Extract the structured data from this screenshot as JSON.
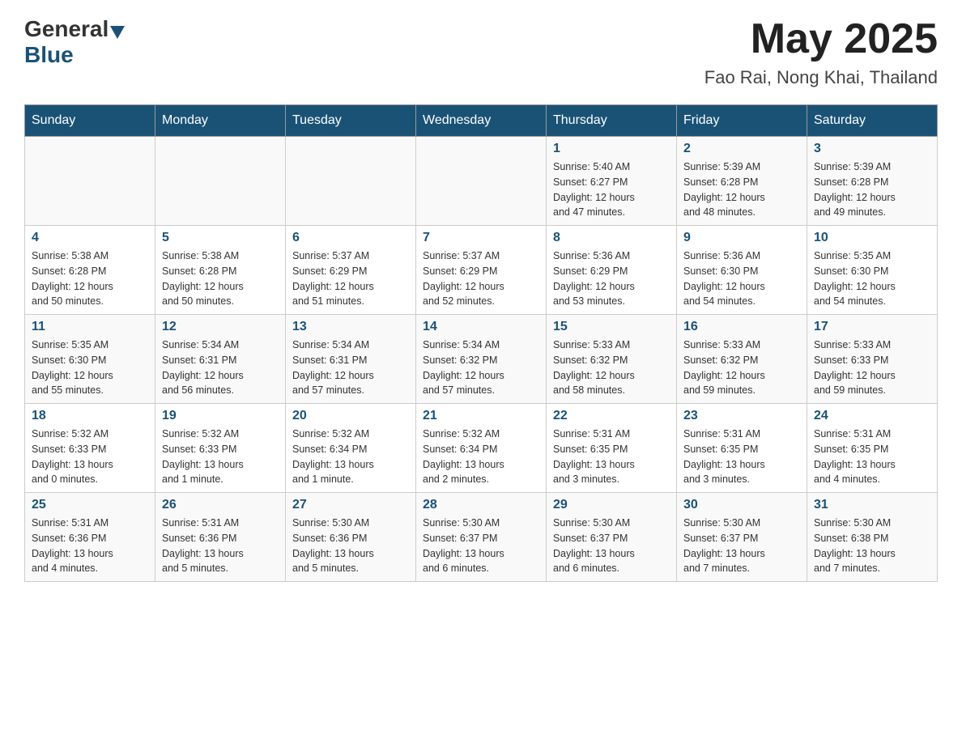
{
  "header": {
    "logo_general": "General",
    "logo_blue": "Blue",
    "title": "May 2025",
    "subtitle": "Fao Rai, Nong Khai, Thailand"
  },
  "calendar": {
    "days_of_week": [
      "Sunday",
      "Monday",
      "Tuesday",
      "Wednesday",
      "Thursday",
      "Friday",
      "Saturday"
    ],
    "weeks": [
      [
        {
          "day": "",
          "info": ""
        },
        {
          "day": "",
          "info": ""
        },
        {
          "day": "",
          "info": ""
        },
        {
          "day": "",
          "info": ""
        },
        {
          "day": "1",
          "info": "Sunrise: 5:40 AM\nSunset: 6:27 PM\nDaylight: 12 hours\nand 47 minutes."
        },
        {
          "day": "2",
          "info": "Sunrise: 5:39 AM\nSunset: 6:28 PM\nDaylight: 12 hours\nand 48 minutes."
        },
        {
          "day": "3",
          "info": "Sunrise: 5:39 AM\nSunset: 6:28 PM\nDaylight: 12 hours\nand 49 minutes."
        }
      ],
      [
        {
          "day": "4",
          "info": "Sunrise: 5:38 AM\nSunset: 6:28 PM\nDaylight: 12 hours\nand 50 minutes."
        },
        {
          "day": "5",
          "info": "Sunrise: 5:38 AM\nSunset: 6:28 PM\nDaylight: 12 hours\nand 50 minutes."
        },
        {
          "day": "6",
          "info": "Sunrise: 5:37 AM\nSunset: 6:29 PM\nDaylight: 12 hours\nand 51 minutes."
        },
        {
          "day": "7",
          "info": "Sunrise: 5:37 AM\nSunset: 6:29 PM\nDaylight: 12 hours\nand 52 minutes."
        },
        {
          "day": "8",
          "info": "Sunrise: 5:36 AM\nSunset: 6:29 PM\nDaylight: 12 hours\nand 53 minutes."
        },
        {
          "day": "9",
          "info": "Sunrise: 5:36 AM\nSunset: 6:30 PM\nDaylight: 12 hours\nand 54 minutes."
        },
        {
          "day": "10",
          "info": "Sunrise: 5:35 AM\nSunset: 6:30 PM\nDaylight: 12 hours\nand 54 minutes."
        }
      ],
      [
        {
          "day": "11",
          "info": "Sunrise: 5:35 AM\nSunset: 6:30 PM\nDaylight: 12 hours\nand 55 minutes."
        },
        {
          "day": "12",
          "info": "Sunrise: 5:34 AM\nSunset: 6:31 PM\nDaylight: 12 hours\nand 56 minutes."
        },
        {
          "day": "13",
          "info": "Sunrise: 5:34 AM\nSunset: 6:31 PM\nDaylight: 12 hours\nand 57 minutes."
        },
        {
          "day": "14",
          "info": "Sunrise: 5:34 AM\nSunset: 6:32 PM\nDaylight: 12 hours\nand 57 minutes."
        },
        {
          "day": "15",
          "info": "Sunrise: 5:33 AM\nSunset: 6:32 PM\nDaylight: 12 hours\nand 58 minutes."
        },
        {
          "day": "16",
          "info": "Sunrise: 5:33 AM\nSunset: 6:32 PM\nDaylight: 12 hours\nand 59 minutes."
        },
        {
          "day": "17",
          "info": "Sunrise: 5:33 AM\nSunset: 6:33 PM\nDaylight: 12 hours\nand 59 minutes."
        }
      ],
      [
        {
          "day": "18",
          "info": "Sunrise: 5:32 AM\nSunset: 6:33 PM\nDaylight: 13 hours\nand 0 minutes."
        },
        {
          "day": "19",
          "info": "Sunrise: 5:32 AM\nSunset: 6:33 PM\nDaylight: 13 hours\nand 1 minute."
        },
        {
          "day": "20",
          "info": "Sunrise: 5:32 AM\nSunset: 6:34 PM\nDaylight: 13 hours\nand 1 minute."
        },
        {
          "day": "21",
          "info": "Sunrise: 5:32 AM\nSunset: 6:34 PM\nDaylight: 13 hours\nand 2 minutes."
        },
        {
          "day": "22",
          "info": "Sunrise: 5:31 AM\nSunset: 6:35 PM\nDaylight: 13 hours\nand 3 minutes."
        },
        {
          "day": "23",
          "info": "Sunrise: 5:31 AM\nSunset: 6:35 PM\nDaylight: 13 hours\nand 3 minutes."
        },
        {
          "day": "24",
          "info": "Sunrise: 5:31 AM\nSunset: 6:35 PM\nDaylight: 13 hours\nand 4 minutes."
        }
      ],
      [
        {
          "day": "25",
          "info": "Sunrise: 5:31 AM\nSunset: 6:36 PM\nDaylight: 13 hours\nand 4 minutes."
        },
        {
          "day": "26",
          "info": "Sunrise: 5:31 AM\nSunset: 6:36 PM\nDaylight: 13 hours\nand 5 minutes."
        },
        {
          "day": "27",
          "info": "Sunrise: 5:30 AM\nSunset: 6:36 PM\nDaylight: 13 hours\nand 5 minutes."
        },
        {
          "day": "28",
          "info": "Sunrise: 5:30 AM\nSunset: 6:37 PM\nDaylight: 13 hours\nand 6 minutes."
        },
        {
          "day": "29",
          "info": "Sunrise: 5:30 AM\nSunset: 6:37 PM\nDaylight: 13 hours\nand 6 minutes."
        },
        {
          "day": "30",
          "info": "Sunrise: 5:30 AM\nSunset: 6:37 PM\nDaylight: 13 hours\nand 7 minutes."
        },
        {
          "day": "31",
          "info": "Sunrise: 5:30 AM\nSunset: 6:38 PM\nDaylight: 13 hours\nand 7 minutes."
        }
      ]
    ]
  }
}
